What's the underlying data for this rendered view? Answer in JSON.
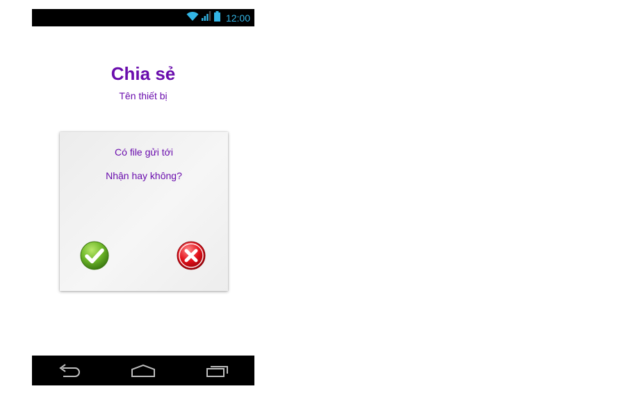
{
  "status_bar": {
    "time": "12:00",
    "icons": [
      "wifi-icon",
      "signal-icon",
      "battery-icon"
    ],
    "accent_color": "#33b5e5"
  },
  "header": {
    "title": "Chia sẻ",
    "subtitle": "Tên thiết bị",
    "text_color": "#6a0dad"
  },
  "dialog": {
    "message_line1": "Có file gửi tới",
    "message_line2": "Nhận hay không?",
    "accept_icon": "check-icon",
    "reject_icon": "close-icon",
    "accept_color": "#5aa81e",
    "reject_color": "#e0101a"
  },
  "nav_bar": {
    "buttons": [
      "back-icon",
      "home-icon",
      "recent-apps-icon"
    ]
  }
}
